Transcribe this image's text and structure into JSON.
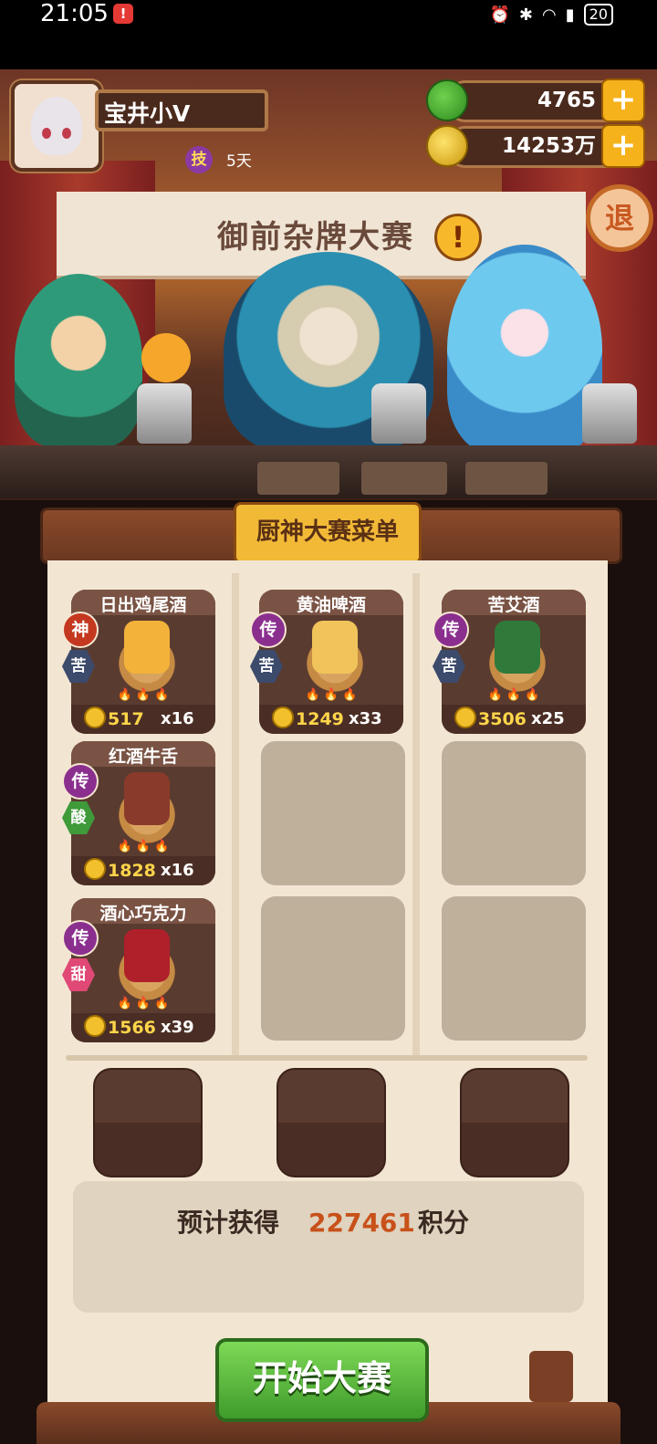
{
  "status_bar": {
    "time": "21:05",
    "notification_badge": "!",
    "battery": "20"
  },
  "player": {
    "name": "宝井小V",
    "skill_icon": "技",
    "skill_days": "5天"
  },
  "currencies": {
    "apples": "4765",
    "coins": "14253万",
    "plus_label": "+"
  },
  "exit_label": "退",
  "banner_title": "御前杂牌大赛",
  "alert_mark": "!",
  "menu_title": "厨神大赛菜单",
  "dishes": [
    {
      "name": "日出鸡尾酒",
      "grade": "神",
      "taste": "苦",
      "price": "517",
      "qty": "x16",
      "food_color": "#f3b23a"
    },
    {
      "name": "黄油啤酒",
      "grade": "传",
      "taste": "苦",
      "price": "1249",
      "qty": "x33",
      "food_color": "#f0c45a"
    },
    {
      "name": "苦艾酒",
      "grade": "传",
      "taste": "苦",
      "price": "3506",
      "qty": "x25",
      "food_color": "#2f7a3a"
    },
    {
      "name": "红酒牛舌",
      "grade": "传",
      "taste": "酸",
      "price": "1828",
      "qty": "x16",
      "food_color": "#8a3a2a"
    },
    {
      "name": "酒心巧克力",
      "grade": "传",
      "taste": "甜",
      "price": "1566",
      "qty": "x39",
      "food_color": "#b0202a"
    }
  ],
  "flames": "🔥🔥🔥",
  "score": {
    "label": "预计获得",
    "value": "227461",
    "unit": "积分"
  },
  "start_button": "开始大赛"
}
